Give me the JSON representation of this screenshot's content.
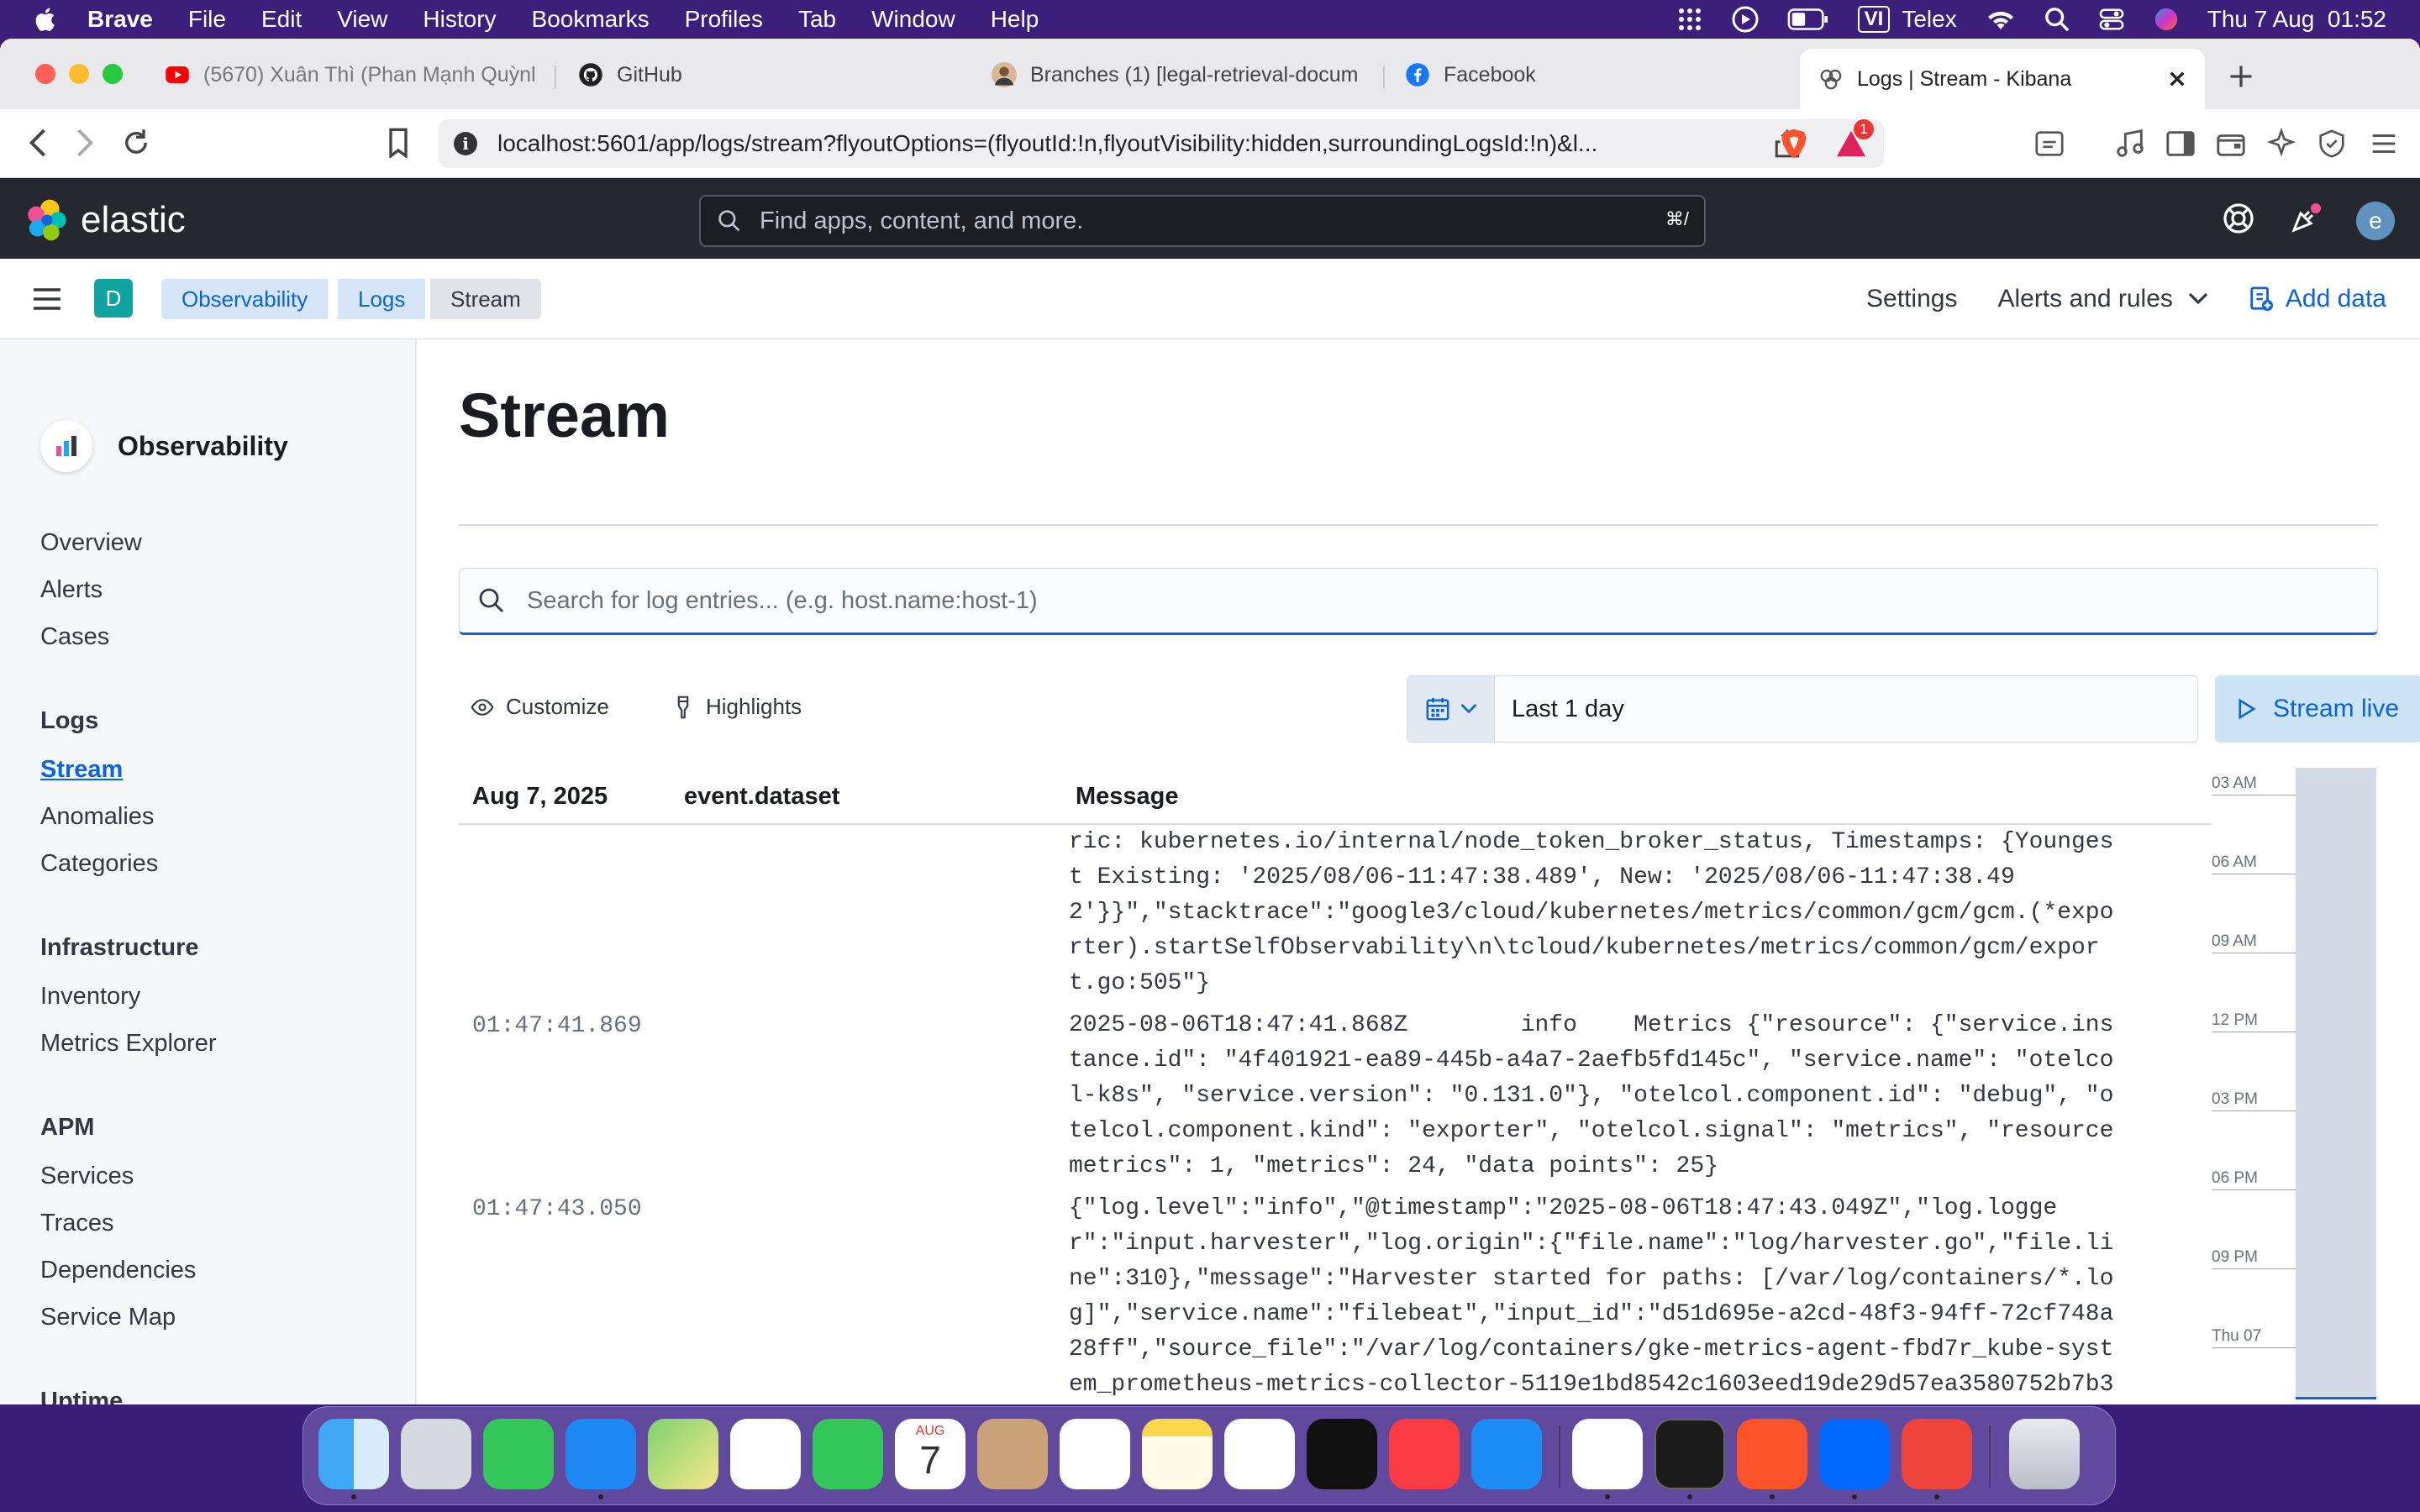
{
  "menubar": {
    "app": "Brave",
    "items": [
      "File",
      "Edit",
      "View",
      "History",
      "Bookmarks",
      "Profiles",
      "Tab",
      "Window",
      "Help"
    ],
    "input_source": "VI",
    "input_method": "Telex",
    "datetime": "Thu 7 Aug  01:52"
  },
  "tabs": [
    {
      "title": "(5670) Xuân Thì (Phan Mạnh Quỳnh",
      "icon": "youtube-icon"
    },
    {
      "title": "GitHub",
      "icon": "github-icon"
    },
    {
      "title": "Branches (1) [legal-retrieval-docum",
      "icon": "avatar-icon"
    },
    {
      "title": "Facebook",
      "icon": "facebook-icon"
    },
    {
      "title": "Logs | Stream - Kibana",
      "icon": "kibana-icon",
      "active": true
    }
  ],
  "address_bar": {
    "url": "localhost:5601/app/logs/stream?flyoutOptions=(flyoutId:!n,flyoutVisibility:hidden,surroundingLogsId:!n)&l...",
    "rewards_badge": "1"
  },
  "kibana_header": {
    "brand": "elastic",
    "search_placeholder": "Find apps, content, and more.",
    "search_shortcut": "⌘/",
    "user_initial": "e"
  },
  "breadcrumbs": {
    "space_initial": "D",
    "items": [
      "Observability",
      "Logs",
      "Stream"
    ],
    "settings": "Settings",
    "alerts": "Alerts and rules",
    "add_data": "Add data"
  },
  "sidebar": {
    "title": "Observability",
    "top_items": [
      "Overview",
      "Alerts",
      "Cases"
    ],
    "sections": [
      {
        "heading": "Logs",
        "items": [
          "Stream",
          "Anomalies",
          "Categories"
        ]
      },
      {
        "heading": "Infrastructure",
        "items": [
          "Inventory",
          "Metrics Explorer"
        ]
      },
      {
        "heading": "APM",
        "items": [
          "Services",
          "Traces",
          "Dependencies",
          "Service Map"
        ]
      },
      {
        "heading": "Uptime",
        "items": []
      }
    ],
    "active_item": "Stream"
  },
  "page": {
    "title": "Stream",
    "search_placeholder": "Search for log entries... (e.g. host.name:host-1)",
    "customize": "Customize",
    "highlights": "Highlights",
    "time_range": "Last 1 day",
    "stream_live": "Stream live"
  },
  "log_table": {
    "columns": [
      "Aug 7, 2025",
      "event.dataset",
      "Message"
    ],
    "rows": [
      {
        "timestamp": "",
        "message": "ric: kubernetes.io/internal/node_token_broker_status, Timestamps: {Younges\nt Existing: '2025/08/06-11:47:38.489', New: '2025/08/06-11:47:38.49\n2'}}\",\"stacktrace\":\"google3/cloud/kubernetes/metrics/common/gcm/gcm.(*expo\nrter).startSelfObservability\\n\\tcloud/kubernetes/metrics/common/gcm/expor\nt.go:505\"}"
      },
      {
        "timestamp": "01:47:41.869",
        "message": "2025-08-06T18:47:41.868Z        info    Metrics {\"resource\": {\"service.ins\ntance.id\": \"4f401921-ea89-445b-a4a7-2aefb5fd145c\", \"service.name\": \"otelco\nl-k8s\", \"service.version\": \"0.131.0\"}, \"otelcol.component.id\": \"debug\", \"o\ntelcol.component.kind\": \"exporter\", \"otelcol.signal\": \"metrics\", \"resource\nmetrics\": 1, \"metrics\": 24, \"data points\": 25}"
      },
      {
        "timestamp": "01:47:43.050",
        "message": "{\"log.level\":\"info\",\"@timestamp\":\"2025-08-06T18:47:43.049Z\",\"log.logge\nr\":\"input.harvester\",\"log.origin\":{\"file.name\":\"log/harvester.go\",\"file.li\nne\":310},\"message\":\"Harvester started for paths: [/var/log/containers/*.lo\ng]\",\"service.name\":\"filebeat\",\"input_id\":\"d51d695e-a2cd-48f3-94ff-72cf748a\n28ff\",\"source_file\":\"/var/log/containers/gke-metrics-agent-fbd7r_kube-syst\nem_prometheus-metrics-collector-5119e1bd8542c1603eed19de29d57ea3580752b7b3"
      }
    ]
  },
  "minimap": {
    "labels": [
      "03 AM",
      "06 AM",
      "09 AM",
      "12 PM",
      "03 PM",
      "06 PM",
      "09 PM",
      "Thu 07"
    ]
  },
  "dock": {
    "calendar_month": "AUG",
    "calendar_day": "7",
    "apps": [
      "finder-icon",
      "launchpad-icon",
      "messages-icon",
      "mail-icon",
      "maps-icon",
      "photos-icon",
      "facetime-icon",
      "calendar-icon",
      "contacts-icon",
      "reminders-icon",
      "notes-icon",
      "freeform-icon",
      "apple-tv-icon",
      "music-icon",
      "app-store-icon",
      "vscode-icon",
      "terminal-icon",
      "brave-icon",
      "zalo-icon",
      "anydesk-icon",
      "trash-icon"
    ]
  },
  "colors": {
    "accent": "#0b64dd",
    "kibana_header": "#25282f",
    "sidebar_bg": "#f5f7fa"
  }
}
